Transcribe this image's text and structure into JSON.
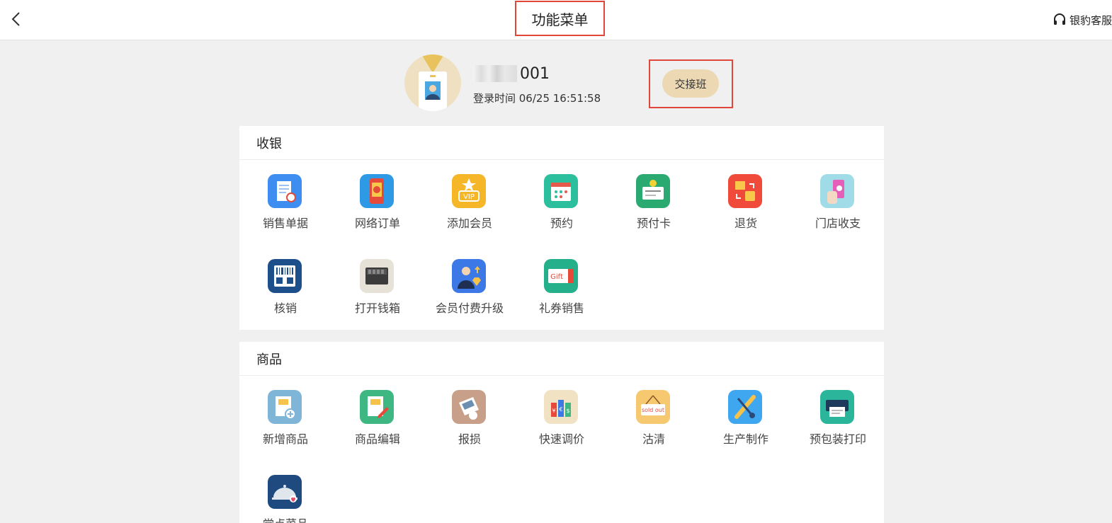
{
  "header": {
    "title": "功能菜单",
    "support_label": "银豹客服"
  },
  "profile": {
    "user_suffix": "001",
    "login_time": "登录时间 06/25 16:51:58",
    "handover_label": "交接班"
  },
  "sections": [
    {
      "title": "收银",
      "items": [
        {
          "label": "销售单据",
          "icon": "sales-receipt-icon"
        },
        {
          "label": "网络订单",
          "icon": "online-order-icon"
        },
        {
          "label": "添加会员",
          "icon": "vip-member-icon"
        },
        {
          "label": "预约",
          "icon": "appointment-calendar-icon"
        },
        {
          "label": "预付卡",
          "icon": "prepaid-card-icon"
        },
        {
          "label": "退货",
          "icon": "return-goods-icon"
        },
        {
          "label": "门店收支",
          "icon": "store-income-expense-icon"
        },
        {
          "label": "核销",
          "icon": "qr-verify-icon"
        },
        {
          "label": "打开钱箱",
          "icon": "cash-drawer-icon"
        },
        {
          "label": "会员付费升级",
          "icon": "member-upgrade-icon"
        },
        {
          "label": "礼券销售",
          "icon": "gift-coupon-icon"
        }
      ]
    },
    {
      "title": "商品",
      "items": [
        {
          "label": "新增商品",
          "icon": "add-product-icon"
        },
        {
          "label": "商品编辑",
          "icon": "edit-product-icon"
        },
        {
          "label": "报损",
          "icon": "damage-report-icon"
        },
        {
          "label": "快速调价",
          "icon": "quick-price-icon"
        },
        {
          "label": "沽清",
          "icon": "sold-out-icon"
        },
        {
          "label": "生产制作",
          "icon": "production-icon"
        },
        {
          "label": "预包装打印",
          "icon": "prepack-print-icon"
        },
        {
          "label": "堂点菜品",
          "icon": "dine-in-dish-icon"
        }
      ]
    }
  ]
}
